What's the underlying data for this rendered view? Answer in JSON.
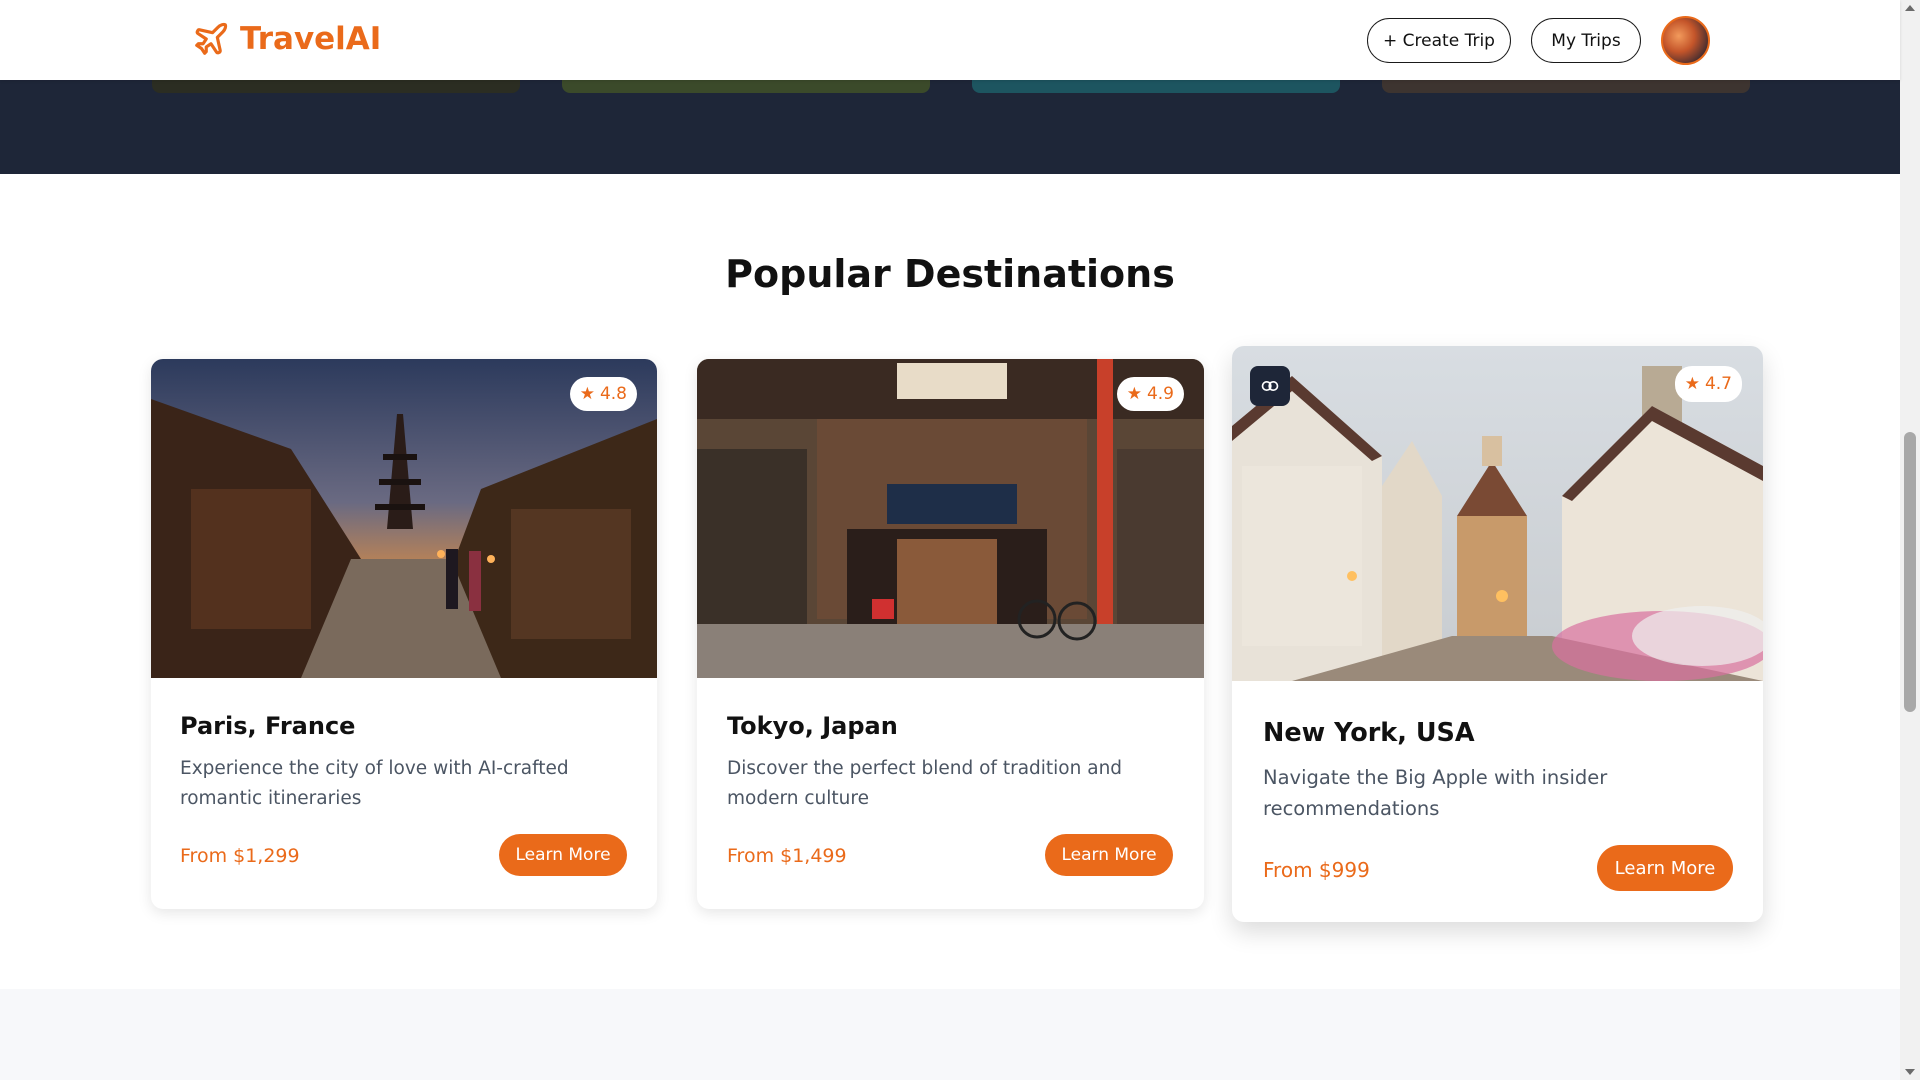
{
  "header": {
    "brand": "TravelAI",
    "create_trip_label": "+ Create Trip",
    "my_trips_label": "My Trips"
  },
  "section": {
    "title": "Popular Destinations"
  },
  "destinations": [
    {
      "title": "Paris, France",
      "description": "Experience the city of love with AI-crafted romantic itineraries",
      "price": "From $1,299",
      "rating": "4.8",
      "cta": "Learn More"
    },
    {
      "title": "Tokyo, Japan",
      "description": "Discover the perfect blend of tradition and modern culture",
      "price": "From $1,499",
      "rating": "4.9",
      "cta": "Learn More"
    },
    {
      "title": "New York, USA",
      "description": "Navigate the Big Apple with insider recommendations",
      "price": "From $999",
      "rating": "4.7",
      "cta": "Learn More"
    }
  ],
  "icons": {
    "logo": "airplane-icon",
    "rating": "star-icon",
    "ai_badge": "brain-icon"
  },
  "colors": {
    "accent": "#ea6a1a",
    "dark": "#1e2638",
    "text": "#111111",
    "muted": "#4b5563"
  }
}
